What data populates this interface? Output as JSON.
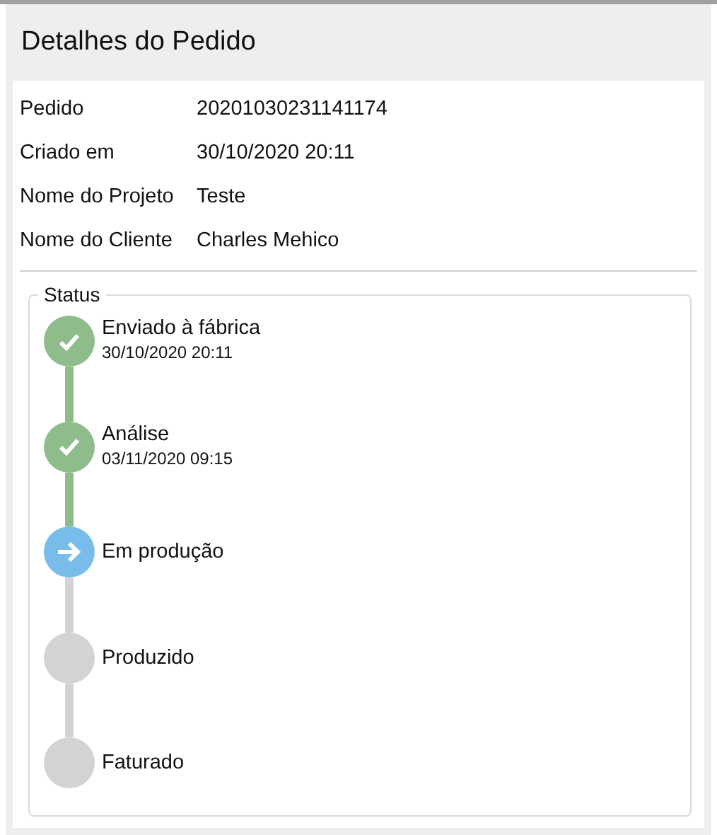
{
  "title": "Detalhes do Pedido",
  "details": [
    {
      "label": "Pedido",
      "value": "20201030231141174"
    },
    {
      "label": "Criado em",
      "value": "30/10/2020 20:11"
    },
    {
      "label": "Nome do Projeto",
      "value": "Teste"
    },
    {
      "label": "Nome do Cliente",
      "value": "Charles Mehico"
    }
  ],
  "status": {
    "legend": "Status",
    "steps": [
      {
        "name": "Enviado à fábrica",
        "date": "30/10/2020 20:11",
        "kind": "done"
      },
      {
        "name": "Análise",
        "date": "03/11/2020 09:15",
        "kind": "done"
      },
      {
        "name": "Em produção",
        "kind": "current"
      },
      {
        "name": "Produzido",
        "kind": "pending"
      },
      {
        "name": "Faturado",
        "kind": "pending"
      }
    ]
  }
}
